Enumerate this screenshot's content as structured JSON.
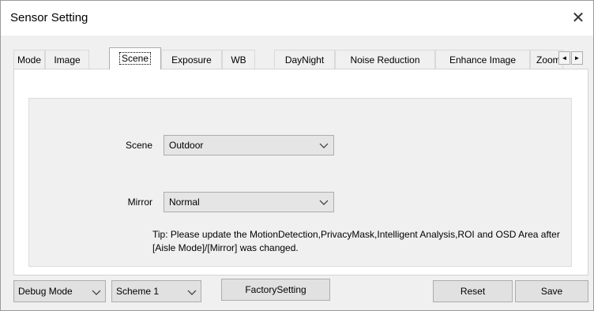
{
  "window": {
    "title": "Sensor Setting",
    "close_glyph": "✕"
  },
  "tabs": [
    {
      "label": "Mode"
    },
    {
      "label": "Image"
    },
    {
      "label": "Scene"
    },
    {
      "label": "Exposure"
    },
    {
      "label": "WB"
    },
    {
      "label": "DayNight"
    },
    {
      "label": "Noise Reduction"
    },
    {
      "label": "Enhance Image"
    },
    {
      "label": "Zoom"
    }
  ],
  "active_tab": "Scene",
  "scroll": {
    "left": "◄",
    "right": "►"
  },
  "form": {
    "scene_label": "Scene",
    "scene_value": "Outdoor",
    "mirror_label": "Mirror",
    "mirror_value": "Normal",
    "tip": "Tip: Please update the MotionDetection,PrivacyMask,Intelligent Analysis,ROI and OSD Area after [Aisle Mode]/[Mirror] was changed."
  },
  "footer": {
    "debug_mode": "Debug Mode",
    "scheme": "Scheme 1",
    "factory_setting": "FactorySetting",
    "reset": "Reset",
    "save": "Save"
  }
}
